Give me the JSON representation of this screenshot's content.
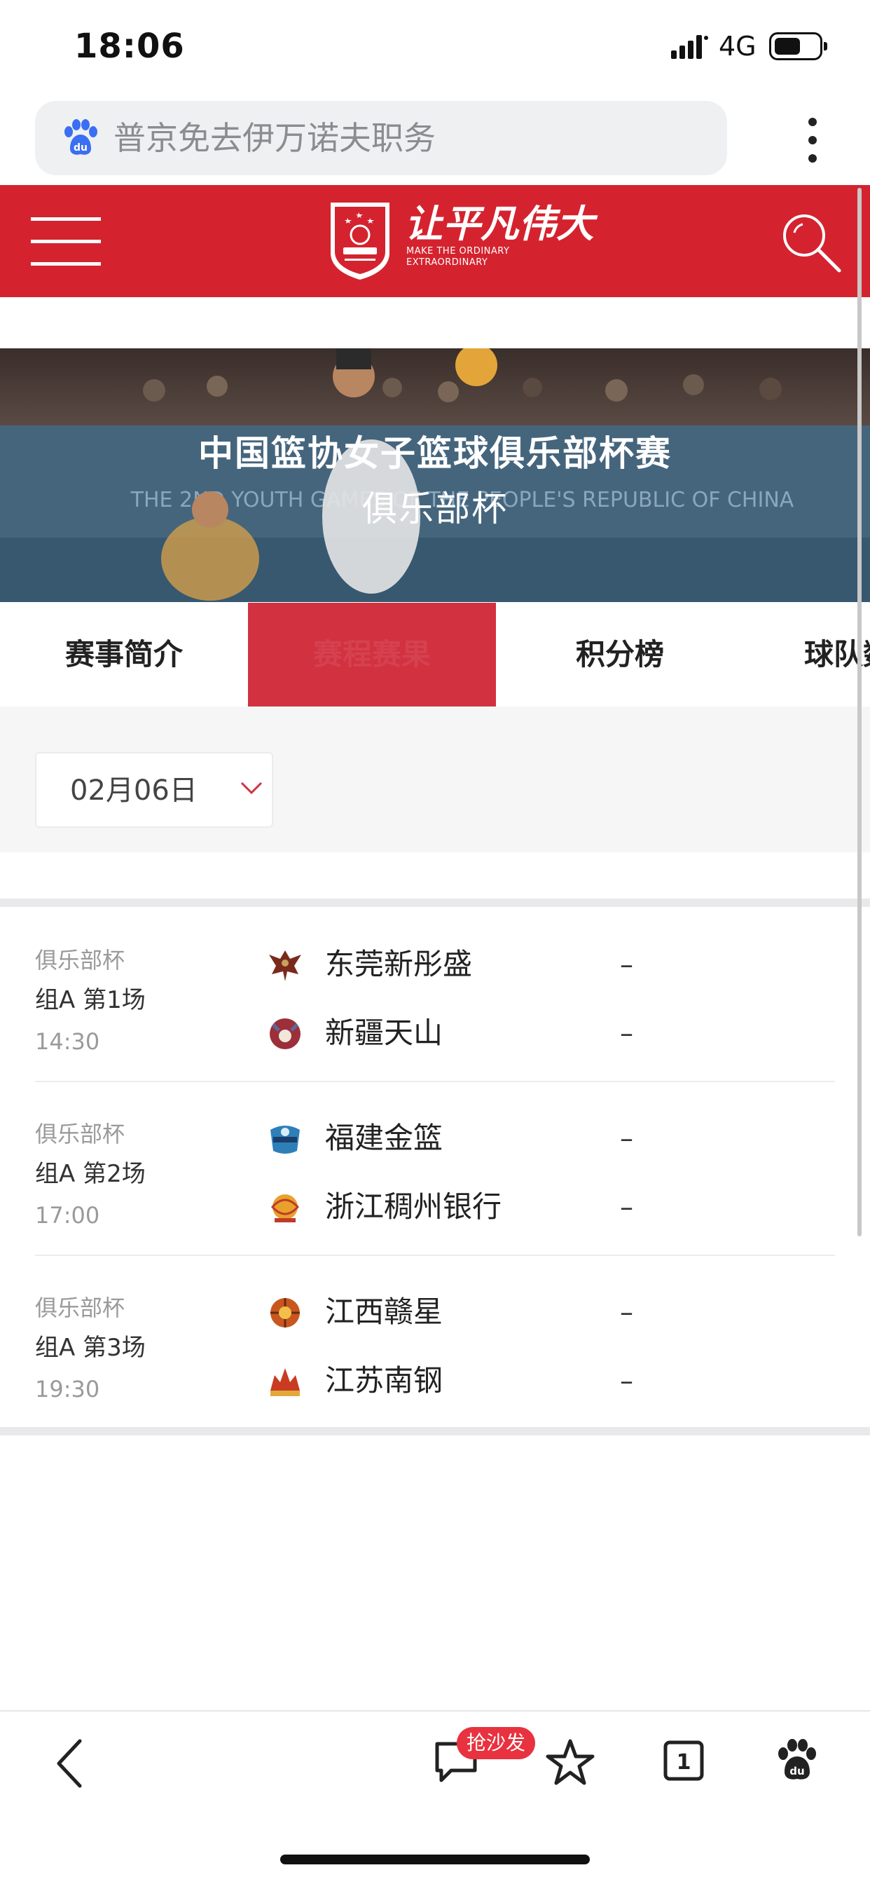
{
  "status_bar": {
    "time": "18:06",
    "network": "4G"
  },
  "browser": {
    "search_text": "普京免去伊万诺夫职务"
  },
  "header": {
    "slogan_cn": "让平凡伟大",
    "slogan_en_line1": "MAKE THE ORDINARY",
    "slogan_en_line2": "EXTRAORDINARY"
  },
  "banner": {
    "title": "中国篮协女子篮球俱乐部杯赛",
    "subtitle": "俱乐部杯"
  },
  "tabs": [
    {
      "label": "赛事简介",
      "active": false
    },
    {
      "label": "赛程赛果",
      "active": true
    },
    {
      "label": "积分榜",
      "active": false
    },
    {
      "label": "球队数据",
      "active": false
    }
  ],
  "filter": {
    "date": "02月06日"
  },
  "matches": [
    {
      "event": "俱乐部杯",
      "round": "组A 第1场",
      "time": "14:30",
      "home": {
        "name": "东莞新彤盛",
        "score": "–"
      },
      "away": {
        "name": "新疆天山",
        "score": "–"
      }
    },
    {
      "event": "俱乐部杯",
      "round": "组A 第2场",
      "time": "17:00",
      "home": {
        "name": "福建金篮",
        "score": "–"
      },
      "away": {
        "name": "浙江稠州银行",
        "score": "–"
      }
    },
    {
      "event": "俱乐部杯",
      "round": "组A 第3场",
      "time": "19:30",
      "home": {
        "name": "江西赣星",
        "score": "–"
      },
      "away": {
        "name": "江苏南钢",
        "score": "–"
      }
    }
  ],
  "toolbar": {
    "sofa_badge": "抢沙发",
    "tab_count": "1"
  },
  "colors": {
    "brand_red": "#d4232f",
    "active_tab": "#d23140",
    "badge_red": "#e8323f"
  }
}
